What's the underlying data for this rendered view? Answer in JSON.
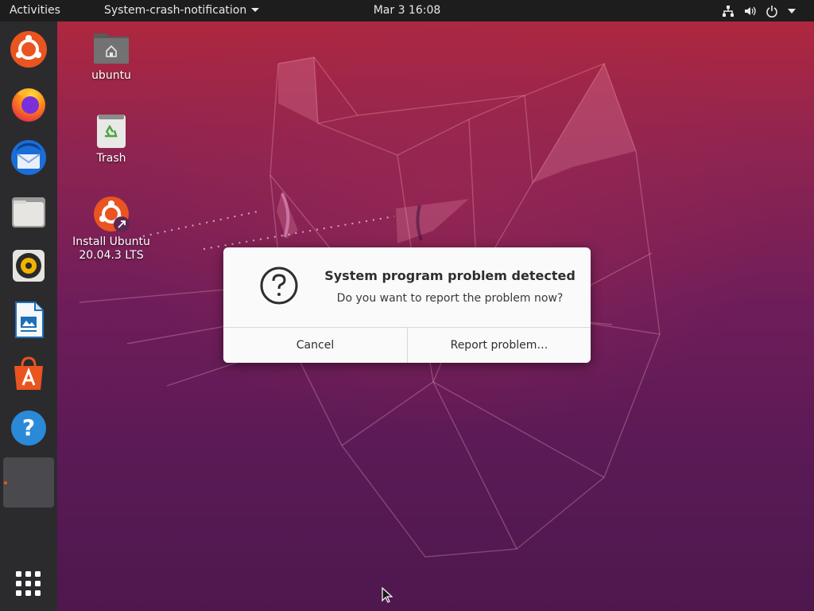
{
  "topbar": {
    "activities_label": "Activities",
    "app_menu_label": "System-crash-notification",
    "clock": "Mar 3  16:08",
    "tray_icons": [
      "network-icon",
      "volume-icon",
      "power-icon",
      "chevron-down-icon"
    ]
  },
  "dock": {
    "items": [
      {
        "name": "Ubuntu installer",
        "icon": "ubuntu-installer-icon"
      },
      {
        "name": "Firefox",
        "icon": "firefox-icon"
      },
      {
        "name": "Thunderbird",
        "icon": "thunderbird-icon"
      },
      {
        "name": "Files",
        "icon": "files-icon"
      },
      {
        "name": "Rhythmbox",
        "icon": "rhythmbox-icon"
      },
      {
        "name": "LibreOffice Writer",
        "icon": "writer-icon"
      },
      {
        "name": "Ubuntu Software",
        "icon": "software-icon"
      },
      {
        "name": "Help",
        "icon": "help-icon"
      }
    ],
    "show_apps_icon": "grid-icon"
  },
  "desktop": {
    "icons": [
      {
        "label": "ubuntu",
        "icon": "home-folder-icon"
      },
      {
        "label": "Trash",
        "icon": "trash-icon"
      },
      {
        "label": "Install Ubuntu 20.04.3 LTS",
        "icon": "install-ubuntu-icon"
      }
    ]
  },
  "dialog": {
    "title": "System program problem detected",
    "message": "Do you want to report the problem now?",
    "icon": "question-icon",
    "cancel_label": "Cancel",
    "report_label": "Report problem…"
  },
  "colors": {
    "accent": "#e95420",
    "topbar": "#1d1d1d",
    "dock": "#2b2b2e",
    "dialog_bg": "#fafafa"
  }
}
